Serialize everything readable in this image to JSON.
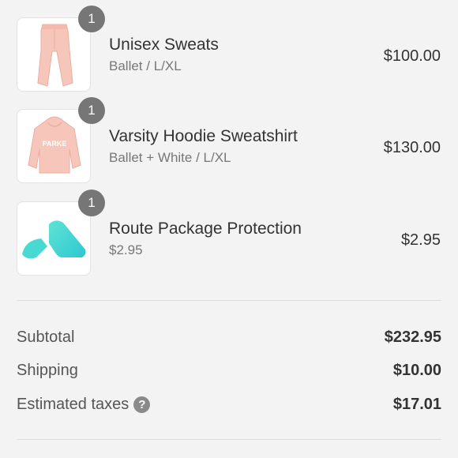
{
  "items": [
    {
      "quantity": "1",
      "name": "Unisex Sweats",
      "variant": "Ballet / L/XL",
      "price": "$100.00",
      "icon": "pink-sweatpants-image"
    },
    {
      "quantity": "1",
      "name": "Varsity Hoodie Sweatshirt",
      "variant": "Ballet + White / L/XL",
      "price": "$130.00",
      "icon": "pink-hoodie-image"
    },
    {
      "quantity": "1",
      "name": "Route Package Protection",
      "variant": "$2.95",
      "price": "$2.95",
      "icon": "route-logo-image"
    }
  ],
  "summary": {
    "subtotal_label": "Subtotal",
    "subtotal_value": "$232.95",
    "shipping_label": "Shipping",
    "shipping_value": "$10.00",
    "taxes_label": "Estimated taxes",
    "taxes_value": "$17.01",
    "help_icon": "?"
  },
  "colors": {
    "background": "#f3f3f3",
    "badge": "#767676",
    "product_pink": "#f6c6bb",
    "route_teal": "#3fd6cf"
  }
}
